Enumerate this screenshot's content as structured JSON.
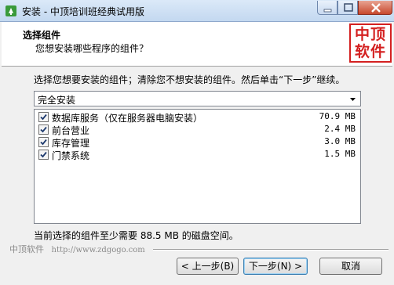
{
  "window": {
    "title": "安装 - 中顶培训班经典试用版"
  },
  "header": {
    "title": "选择组件",
    "subtitle": "您想安装哪些程序的组件？",
    "logo_line1": "中顶",
    "logo_line2": "软件",
    "logo_color": "#d42020"
  },
  "main": {
    "instruction": "选择您想要安装的组件；清除您不想安装的组件。然后单击“下一步”继续。",
    "install_type": "完全安装",
    "components": [
      {
        "name": "数据库服务（仅在服务器电脑安装）",
        "size": "70.9 MB",
        "checked": true
      },
      {
        "name": "前台营业",
        "size": "2.4 MB",
        "checked": true
      },
      {
        "name": "库存管理",
        "size": "3.0 MB",
        "checked": true
      },
      {
        "name": "门禁系统",
        "size": "1.5 MB",
        "checked": true
      }
    ],
    "space_required": "当前选择的组件至少需要 88.5 MB 的磁盘空间。"
  },
  "footer": {
    "brand": "中顶软件",
    "url": "http://www.zdgogo.com",
    "back_label": "< 上一步(B)",
    "next_label": "下一步(N) >",
    "cancel_label": "取消"
  }
}
